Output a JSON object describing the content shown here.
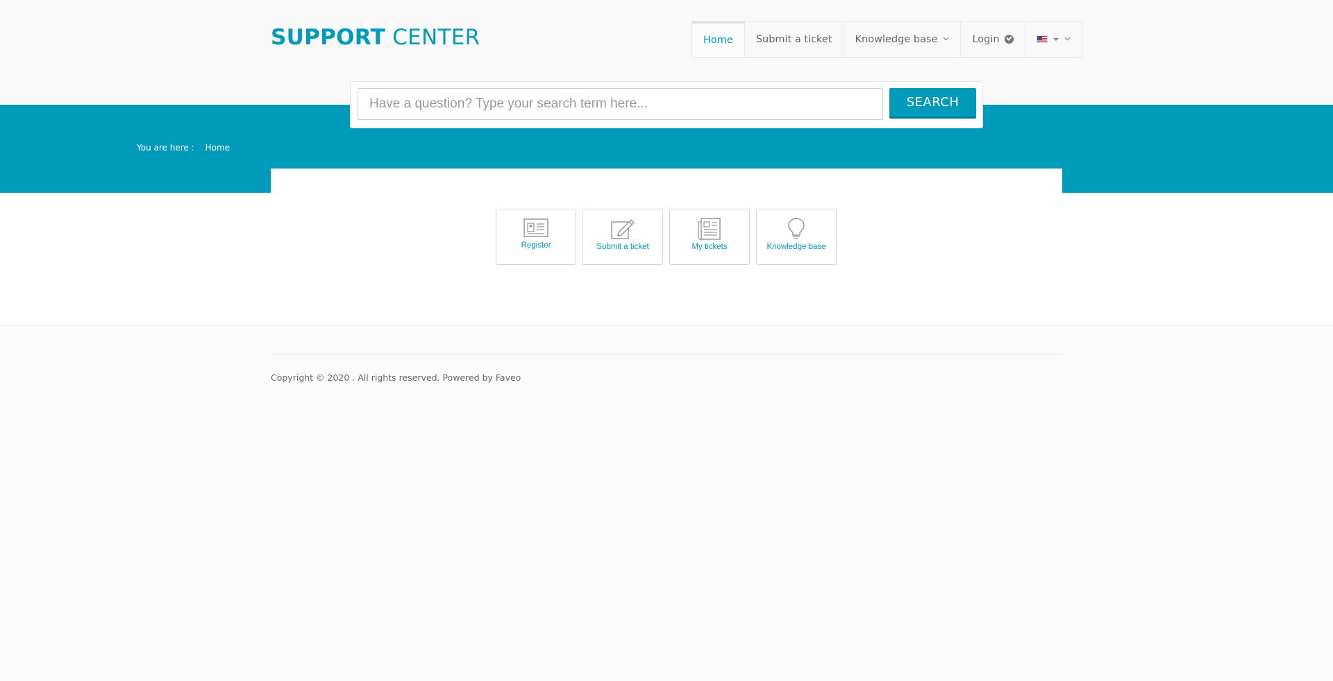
{
  "logo": {
    "bold": "SUPPORT",
    "light": "CENTER"
  },
  "nav": {
    "home": "Home",
    "submit_ticket": "Submit a ticket",
    "knowledge_base": "Knowledge base",
    "login": "Login"
  },
  "search": {
    "placeholder": "Have a question? Type your search term here...",
    "button": "SEARCH"
  },
  "breadcrumb": {
    "prefix": "You are here :",
    "current": "Home"
  },
  "tiles": [
    {
      "label": "Register",
      "icon": "register-card-icon"
    },
    {
      "label": "Submit a ticket",
      "icon": "edit-pencil-icon"
    },
    {
      "label": "My tickets",
      "icon": "tickets-document-icon"
    },
    {
      "label": "Knowledge base",
      "icon": "lightbulb-icon"
    }
  ],
  "footer": {
    "copyright": "Copyright © 2020 . All rights reserved. Powered by",
    "powered_by": "Faveo"
  },
  "colors": {
    "accent": "#009aba",
    "background": "#fbfbfb"
  }
}
